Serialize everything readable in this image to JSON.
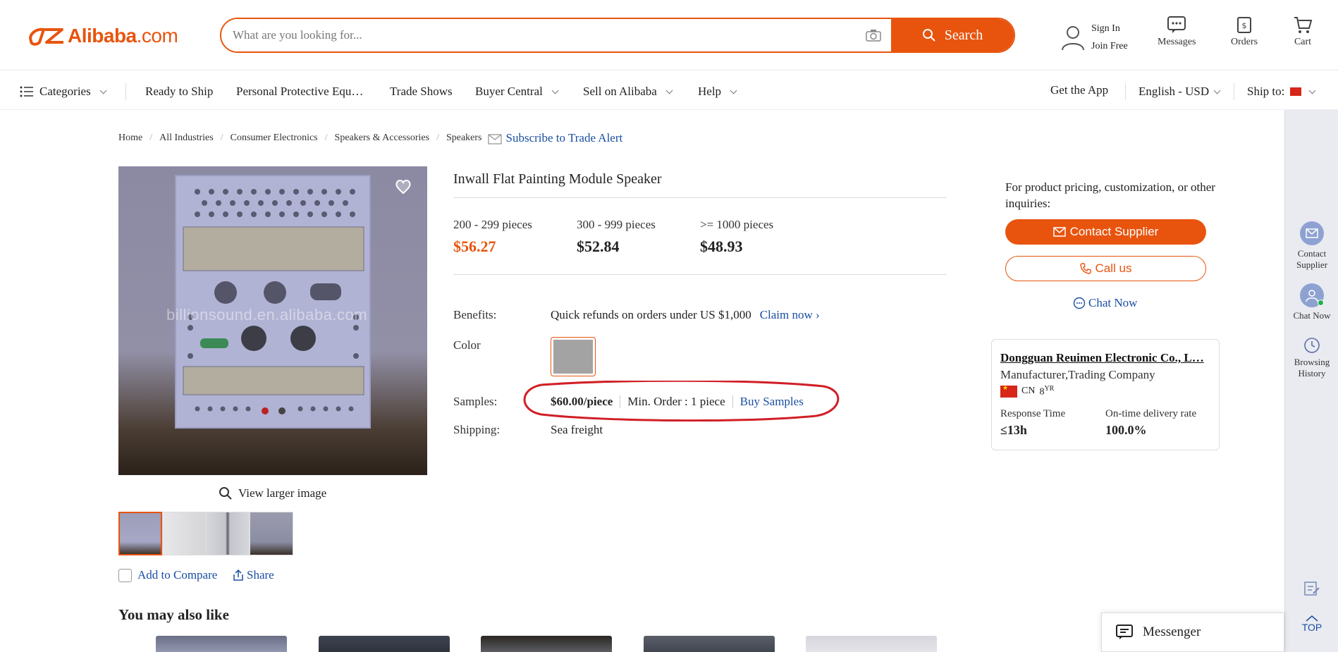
{
  "header": {
    "logo": {
      "brand": "Alibaba",
      "suffix": ".com"
    },
    "search": {
      "placeholder": "What are you looking for...",
      "button_label": "Search"
    },
    "sign_in": "Sign In",
    "join_free": "Join Free",
    "messages": "Messages",
    "orders": "Orders",
    "cart": "Cart"
  },
  "nav": {
    "categories": "Categories",
    "items": [
      "Ready to Ship",
      "Personal Protective Equ…",
      "Trade Shows",
      "Buyer Central",
      "Sell on Alibaba",
      "Help"
    ],
    "get_app": "Get the App",
    "language": "English - USD",
    "ship_to": "Ship to:"
  },
  "breadcrumb": [
    "Home",
    "All Industries",
    "Consumer Electronics",
    "Speakers & Accessories",
    "Speakers"
  ],
  "subscribe": "Subscribe to Trade Alert",
  "gallery": {
    "watermark": "billionsound.en.alibaba.com",
    "view_larger": "View larger image",
    "add_compare": "Add to Compare",
    "share": "Share"
  },
  "product": {
    "title": "Inwall Flat Painting Module Speaker",
    "tiers": [
      {
        "qty": "200 - 299 pieces",
        "price": "$56.27"
      },
      {
        "qty": "300 - 999 pieces",
        "price": "$52.84"
      },
      {
        "qty": ">= 1000 pieces",
        "price": "$48.93"
      }
    ],
    "benefits_label": "Benefits:",
    "benefits_text": "Quick refunds on orders under US $1,000",
    "claim": "Claim now",
    "color_label": "Color",
    "color_value": "#a3a3a3",
    "samples_label": "Samples:",
    "sample_price": "$60.00/piece",
    "sample_min": "Min. Order : 1 piece",
    "buy_samples": "Buy Samples",
    "shipping_label": "Shipping:",
    "shipping_value": "Sea freight"
  },
  "contact": {
    "inquiry": "For product pricing, customization, or other inquiries:",
    "contact_supplier": "Contact Supplier",
    "call_us": "Call us",
    "chat_now": "Chat Now"
  },
  "supplier": {
    "name": "Dongguan Reuimen Electronic Co., L…",
    "type": "Manufacturer,Trading Company",
    "country": "CN",
    "years": "8",
    "years_suffix": "YR",
    "response_label": "Response Time",
    "response_value": "≤13h",
    "delivery_label": "On-time delivery rate",
    "delivery_value": "100.0%"
  },
  "sidebar": {
    "contact": "Contact Supplier",
    "chat": "Chat Now",
    "history": "Browsing History",
    "top": "TOP"
  },
  "messenger": "Messenger",
  "recommend_title": "You may also like",
  "colors": {
    "accent": "#e8540e",
    "link": "#1a4ea2"
  }
}
